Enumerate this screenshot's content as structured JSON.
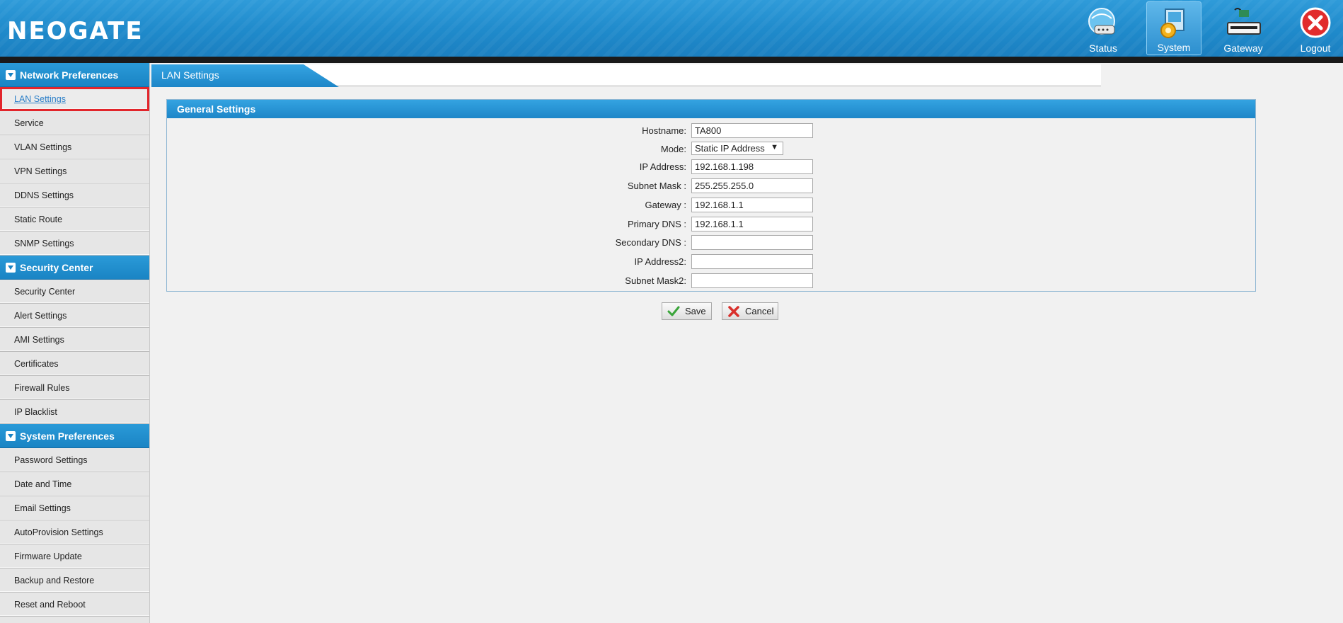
{
  "header": {
    "logo": "NEOGATE",
    "nav": [
      {
        "label": "Status",
        "icon": "status-icon"
      },
      {
        "label": "System",
        "icon": "system-icon",
        "active": true
      },
      {
        "label": "Gateway",
        "icon": "gateway-icon"
      },
      {
        "label": "Logout",
        "icon": "logout-icon"
      }
    ]
  },
  "sidebar": {
    "sections": [
      {
        "title": "Network Preferences",
        "items": [
          "LAN Settings",
          "Service",
          "VLAN Settings",
          "VPN Settings",
          "DDNS Settings",
          "Static Route",
          "SNMP Settings"
        ]
      },
      {
        "title": "Security Center",
        "items": [
          "Security Center",
          "Alert Settings",
          "AMI Settings",
          "Certificates",
          "Firewall Rules",
          "IP Blacklist"
        ]
      },
      {
        "title": "System Preferences",
        "items": [
          "Password Settings",
          "Date and Time",
          "Email Settings",
          "AutoProvision Settings",
          "Firmware Update",
          "Backup and Restore",
          "Reset and Reboot"
        ]
      }
    ],
    "selected": "LAN Settings"
  },
  "main": {
    "tab": "LAN Settings",
    "panel_title": "General Settings",
    "fields": {
      "hostname": {
        "label": "Hostname:",
        "value": "TA800"
      },
      "mode": {
        "label": "Mode:",
        "value": "Static IP Address"
      },
      "ip_address": {
        "label": "IP Address:",
        "value": "192.168.1.198"
      },
      "subnet_mask": {
        "label": "Subnet Mask :",
        "value": "255.255.255.0"
      },
      "gateway": {
        "label": "Gateway :",
        "value": "192.168.1.1"
      },
      "primary_dns": {
        "label": "Primary DNS :",
        "value": "192.168.1.1"
      },
      "secondary_dns": {
        "label": "Secondary DNS :",
        "value": ""
      },
      "ip_address2": {
        "label": "IP Address2:",
        "value": ""
      },
      "subnet_mask2": {
        "label": "Subnet Mask2:",
        "value": ""
      }
    },
    "save_label": "Save",
    "cancel_label": "Cancel"
  },
  "colors": {
    "header_blue": "#1f8acb",
    "selected_border": "#e2252b",
    "link_blue": "#2c7fc8"
  }
}
